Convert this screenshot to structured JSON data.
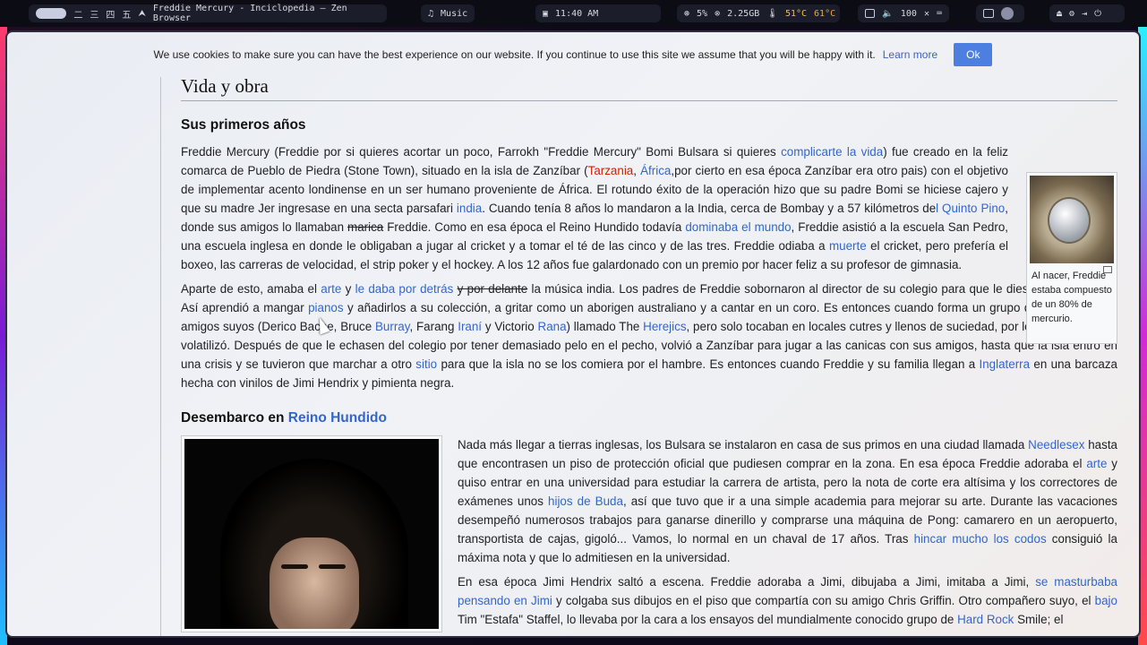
{
  "topbar": {
    "workspaces": [
      "二",
      "三",
      "四",
      "五"
    ],
    "window_title": "Freddie Mercury - Inciclopedia — Zen Browser",
    "music_label": "Music",
    "time": "11:40 AM",
    "cpu": "5%",
    "memory": "2.25GB",
    "temp1": "51°C",
    "temp2": "61°C",
    "volume": "100"
  },
  "cookie_bar": {
    "text": "We use cookies to make sure you can have the best experience on our website. If you continue to use this site we assume that you will be happy with it.",
    "learn_more": "Learn more",
    "ok": "Ok"
  },
  "article": {
    "h2": "Vida y obra",
    "h3_1": "Sus primeros años",
    "h3_2_prefix": "Desembarco en ",
    "h3_2_link": "Reino Hundido",
    "thumb_caption": "Al nacer, Freddie estaba compuesto de un 80% de mercurio.",
    "p1": {
      "t1": "Freddie Mercury (Freddie por si quieres acortar un poco, Farrokh \"Freddie Mercury\" Bomi Bulsara si quieres ",
      "l1": "complicarte la vida",
      "t2": ") fue creado en la feliz comarca de Pueblo de Piedra (Stone Town), situado en la isla de Zanzíbar (",
      "r1": "Tarzania",
      "t3": ", ",
      "l2": "África",
      "t4": ",por cierto en esa época Zanzíbar era otro pais) con el objetivo de implementar acento londinense en un ser humano proveniente de África. El rotundo éxito de la operación hizo que su padre Bomi se hiciese cajero y que su madre Jer ingresase en una secta parsafari ",
      "l3": "india",
      "t5": ". Cuando tenía 8 años lo mandaron a la India, cerca de Bombay y a 57 kilómetros de",
      "l4": "l Quinto Pino",
      "t6": ", donde sus amigos lo llamaban ",
      "s1": "marica",
      "t7": " Freddie. Como en esa época el Reino Hundido todavía ",
      "l5": "dominaba el mundo",
      "t8": ", Freddie asistió a la escuela San Pedro, una escuela inglesa en donde le obligaban a jugar al cricket y a tomar el té de las cinco y de las tres. Freddie odiaba a ",
      "l6": "muerte",
      "t9": " el cricket, pero prefería el boxeo, las carreras de velocidad, el strip poker y el hockey. A los 12 años fue galardonado con un premio por hacer feliz a su profesor de gimnasia."
    },
    "p2": {
      "t1": "Aparte de esto, amaba el ",
      "l1": "arte",
      "t2": " y ",
      "s1": "le daba por detrás",
      "t3": " ",
      "s2": "y por delante",
      "t4": " la música india. Los padres de Freddie sobornaron al director de su colegio para que le diesen instrumentos. Así aprendió a mangar ",
      "l2": "pianos",
      "t5": " y añadirlos a su colección, a gritar como un aborigen australiano y a cantar en un coro. Es entonces cuando forma un grupo de rock con unos amigos suyos (Derico Bache, Bruce ",
      "l3": "Burray",
      "t6": ", Farang ",
      "l4": "Iraní",
      "t7": " y Victorio ",
      "l5": "Rana",
      "t8": ") llamado The ",
      "l6": "Herejics",
      "t9": ", pero solo tocaban en locales cutres y llenos de suciedad, por lo que el grupo se volatilizó. Después de que le echasen del colegio por tener demasiado pelo en el pecho, volvió a Zanzíbar para jugar a las canicas con sus amigos, hasta que la isla entró en una crisis y se tuvieron que marchar a otro ",
      "l7": "sitio",
      "t10": " para que la isla no se los comiera por el hambre. Es entonces cuando Freddie y su familia llegan a ",
      "l8": "Inglaterra",
      "t11": " en una barcaza hecha con vinilos de Jimi Hendrix y pimienta negra."
    },
    "p3": {
      "t1": "Nada más llegar a tierras inglesas, los Bulsara se instalaron en casa de sus primos en una ciudad llamada ",
      "l1": "Needlesex",
      "t2": " hasta que encontrasen un piso de protección oficial que pudiesen comprar en la zona. En esa época Freddie adoraba el ",
      "l2": "arte",
      "t3": " y quiso entrar en una universidad para estudiar la carrera de artista, pero la nota de corte era altísima y los correctores de exámenes unos ",
      "l3": "hijos de Buda",
      "t4": ", así que tuvo que ir a una simple academia para mejorar su arte. Durante las vacaciones desempeñó numerosos trabajos para ganarse dinerillo y comprarse una máquina de Pong: camarero en un aeropuerto, transportista de cajas, gigoló... Vamos, lo normal en un chaval de 17 años. Tras ",
      "l4": "hincar mucho los codos",
      "t5": " consiguió la máxima nota y que lo admitiesen en la universidad."
    },
    "p4": {
      "t1": "En esa época Jimi Hendrix saltó a escena. Freddie adoraba a Jimi, dibujaba a Jimi, imitaba a Jimi, ",
      "s1": "se masturbaba pensando en Jimi",
      "t2": " y colgaba sus dibujos en el piso que compartía con su amigo Chris Griffin. Otro compañero suyo, el ",
      "l1": "bajo",
      "t3": " Tim \"Estafa\" Staffel, lo llevaba por la cara a los ensayos del mundialmente conocido grupo de ",
      "l2": "Hard Rock",
      "t4": " Smile; el"
    }
  }
}
